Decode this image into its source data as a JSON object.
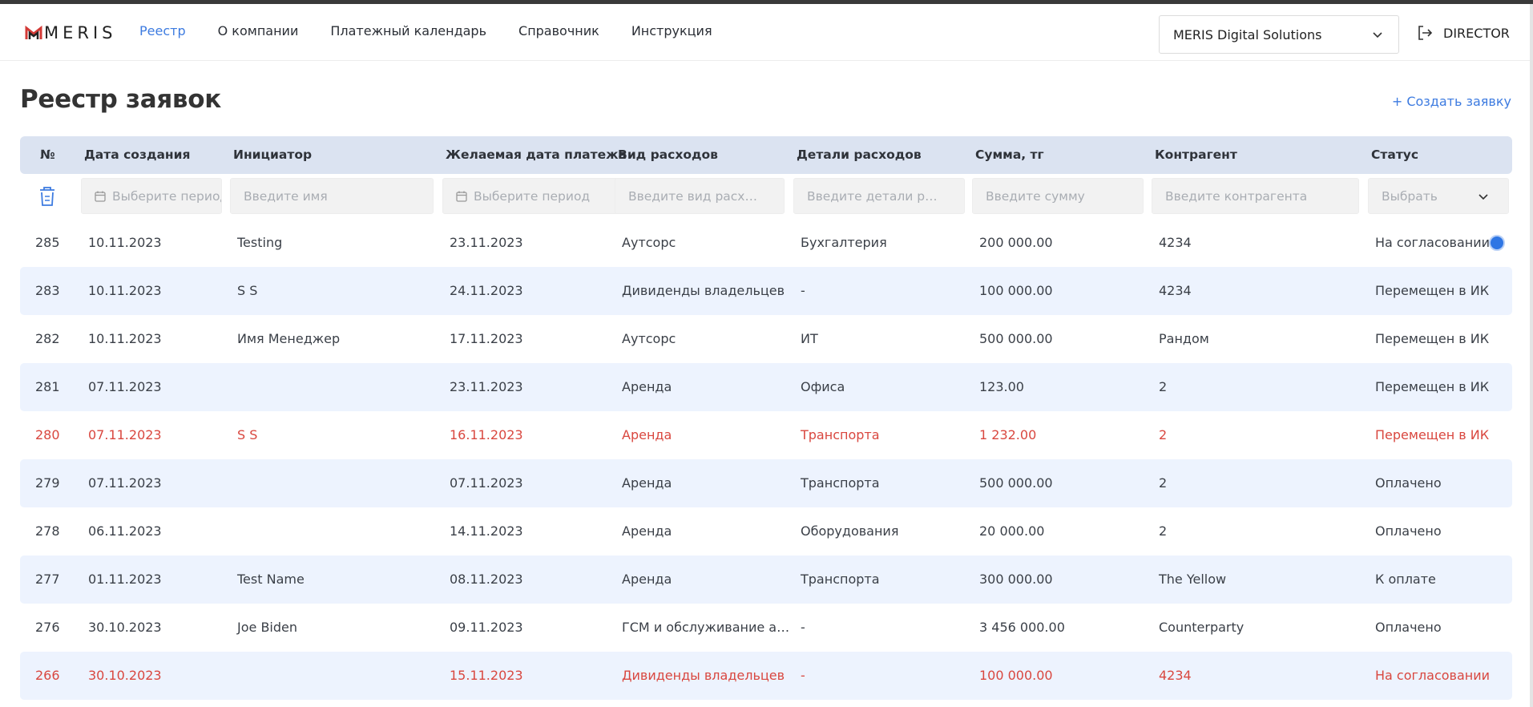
{
  "app": {
    "logo_text": "MERIS"
  },
  "nav": {
    "items": [
      {
        "label": "Реестр",
        "active": true
      },
      {
        "label": "О компании",
        "active": false
      },
      {
        "label": "Платежный календарь",
        "active": false
      },
      {
        "label": "Справочник",
        "active": false
      },
      {
        "label": "Инструкция",
        "active": false
      }
    ]
  },
  "company": {
    "selected": "MERIS Digital Solutions"
  },
  "user": {
    "role": "DIRECTOR"
  },
  "page": {
    "title": "Реестр заявок",
    "create_label": "+ Создать заявку"
  },
  "table": {
    "headers": [
      "№",
      "Дата создания",
      "Инициатор",
      "Желаемая дата платежа",
      "Вид расходов",
      "Детали расходов",
      "Сумма, тг",
      "Контрагент",
      "Статус"
    ],
    "filters": {
      "created_date": "Выберите период",
      "initiator": "Введите имя",
      "payment_date": "Выберите период",
      "expense_type": "Введите вид расх…",
      "expense_details": "Введите детали р…",
      "amount": "Введите сумму",
      "counterparty": "Введите контрагента",
      "status": "Выбрать"
    },
    "rows": [
      {
        "no": "285",
        "created": "10.11.2023",
        "initiator": "Testing",
        "pay_date": "23.11.2023",
        "type": "Аутсорс",
        "details": "Бухгалтерия",
        "amount": "200 000.00",
        "counterparty": "4234",
        "status": "На согласовании",
        "highlight": false,
        "overdue": false
      },
      {
        "no": "283",
        "created": "10.11.2023",
        "initiator": "S S",
        "pay_date": "24.11.2023",
        "type": "Дивиденды владельцев",
        "details": "-",
        "amount": "100 000.00",
        "counterparty": "4234",
        "status": "Перемещен в ИК",
        "highlight": true,
        "overdue": false
      },
      {
        "no": "282",
        "created": "10.11.2023",
        "initiator": "Имя Менеджер",
        "pay_date": "17.11.2023",
        "type": "Аутсорс",
        "details": "ИТ",
        "amount": "500 000.00",
        "counterparty": "Рандом",
        "status": "Перемещен в ИК",
        "highlight": false,
        "overdue": false
      },
      {
        "no": "281",
        "created": "07.11.2023",
        "initiator": "",
        "pay_date": "23.11.2023",
        "type": "Аренда",
        "details": "Офиса",
        "amount": "123.00",
        "counterparty": "2",
        "status": "Перемещен в ИК",
        "highlight": true,
        "overdue": false
      },
      {
        "no": "280",
        "created": "07.11.2023",
        "initiator": "S S",
        "pay_date": "16.11.2023",
        "type": "Аренда",
        "details": "Транспорта",
        "amount": "1 232.00",
        "counterparty": "2",
        "status": "Перемещен в ИК",
        "highlight": false,
        "overdue": true
      },
      {
        "no": "279",
        "created": "07.11.2023",
        "initiator": "",
        "pay_date": "07.11.2023",
        "type": "Аренда",
        "details": "Транспорта",
        "amount": "500 000.00",
        "counterparty": "2",
        "status": "Оплачено",
        "highlight": true,
        "overdue": false
      },
      {
        "no": "278",
        "created": "06.11.2023",
        "initiator": "",
        "pay_date": "14.11.2023",
        "type": "Аренда",
        "details": "Оборудования",
        "amount": "20 000.00",
        "counterparty": "2",
        "status": "Оплачено",
        "highlight": false,
        "overdue": false
      },
      {
        "no": "277",
        "created": "01.11.2023",
        "initiator": "Test Name",
        "pay_date": "08.11.2023",
        "type": "Аренда",
        "details": "Транспорта",
        "amount": "300 000.00",
        "counterparty": "The Yellow",
        "status": "К оплате",
        "highlight": true,
        "overdue": false
      },
      {
        "no": "276",
        "created": "30.10.2023",
        "initiator": "Joe Biden",
        "pay_date": "09.11.2023",
        "type": "ГСМ и обслуживание а…",
        "details": "-",
        "amount": "3 456 000.00",
        "counterparty": "Counterparty",
        "status": "Оплачено",
        "highlight": false,
        "overdue": false
      },
      {
        "no": "266",
        "created": "30.10.2023",
        "initiator": "",
        "pay_date": "15.11.2023",
        "type": "Дивиденды владельцев",
        "details": "-",
        "amount": "100 000.00",
        "counterparty": "4234",
        "status": "На согласовании",
        "highlight": true,
        "overdue": true
      }
    ]
  },
  "colors": {
    "accent": "#3d7be0",
    "header_bg": "#dbe3f1",
    "alt_row_bg": "#edf3fe",
    "overdue_text": "#d9473f"
  }
}
